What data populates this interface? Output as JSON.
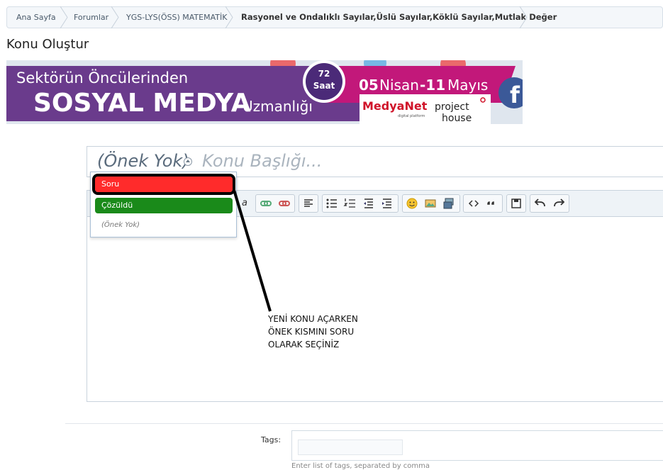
{
  "breadcrumb": {
    "items": [
      "Ana Sayfa",
      "Forumlar",
      "YGS-LYS(ÖSS) MATEMATİK"
    ],
    "current": "Rasyonel ve Ondalıklı Sayılar,Üslü Sayılar,Köklü Sayılar,Mutlak Değer"
  },
  "page": {
    "title": "Konu Oluştur"
  },
  "banner": {
    "line1": "Sektörün Öncülerinden",
    "headline": "SOSYAL MEDYA",
    "suffix": "Uzmanlığı",
    "badge_top": "72",
    "badge_bottom": "Saat",
    "date_a": "05",
    "date_a_month": "Nisan",
    "date_b": "-11",
    "date_b_month": "Mayıs",
    "logo1": "MedyaNet",
    "logo1_sub": "digital platform",
    "logo2_top": "project",
    "logo2_bottom": "house"
  },
  "editor": {
    "prefix_selected": "(Önek Yok)",
    "title_placeholder": "Konu Başlığı...",
    "toolbar_partial": "a"
  },
  "prefix_menu": {
    "options": [
      "Soru",
      "Çözüldü",
      "(Önek Yok)"
    ]
  },
  "annotation": {
    "lines": [
      "YENİ KONU AÇARKEN",
      "ÖNEK KISMINI SORU",
      "OLARAK SEÇİNİZ"
    ]
  },
  "tags": {
    "label": "Tags:",
    "hint": "Enter list of tags, separated by comma"
  },
  "colors": {
    "soru": "#ff2b2b",
    "cozuldu": "#1a8a1a",
    "banner_purple": "#6a3b8c",
    "banner_magenta": "#c2187a"
  }
}
